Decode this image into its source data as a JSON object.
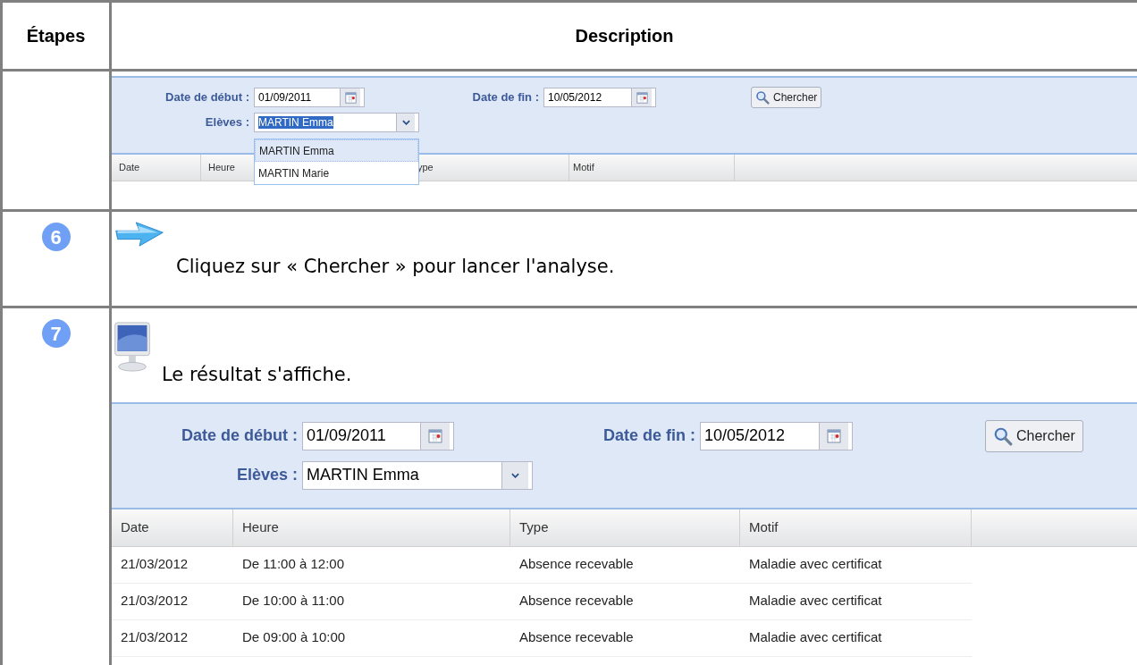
{
  "table": {
    "columns": [
      "Étapes",
      "Description"
    ],
    "steps": [
      {
        "kind": "screen",
        "panel": {
          "start_label": "Date de début :",
          "start_value": "01/09/2011",
          "end_label": "Date de fin :",
          "end_value": "10/05/2012",
          "search_button": "Chercher",
          "student_label": "Elèves :",
          "student_value": "MARTIN Emma",
          "value_highlighted": true
        },
        "dropdown": [
          {
            "label": "MARTIN Emma",
            "selected": true
          },
          {
            "label": "MARTIN Marie",
            "selected": false
          }
        ],
        "grid": {
          "columns": [
            "Date",
            "Heure",
            "ype",
            "Motif"
          ]
        }
      },
      {
        "kind": "instruction",
        "number": "6",
        "text": "Cliquez sur « Chercher » pour lancer l'analyse."
      },
      {
        "kind": "result",
        "number": "7",
        "text": "Le résultat s'affiche.",
        "panel": {
          "start_label": "Date de début :",
          "start_value": "01/09/2011",
          "end_label": "Date de fin :",
          "end_value": "10/05/2012",
          "search_button": "Chercher",
          "student_label": "Elèves :",
          "student_value": "MARTIN Emma",
          "value_highlighted": false
        },
        "grid": {
          "columns": [
            "Date",
            "Heure",
            "Type",
            "Motif"
          ],
          "rows": [
            [
              "21/03/2012",
              "De 11:00 à 12:00",
              "Absence recevable",
              "Maladie avec certificat"
            ],
            [
              "21/03/2012",
              "De 10:00 à 11:00",
              "Absence recevable",
              "Maladie avec certificat"
            ],
            [
              "21/03/2012",
              "De 09:00 à 10:00",
              "Absence recevable",
              "Maladie avec certificat"
            ]
          ]
        }
      }
    ]
  }
}
